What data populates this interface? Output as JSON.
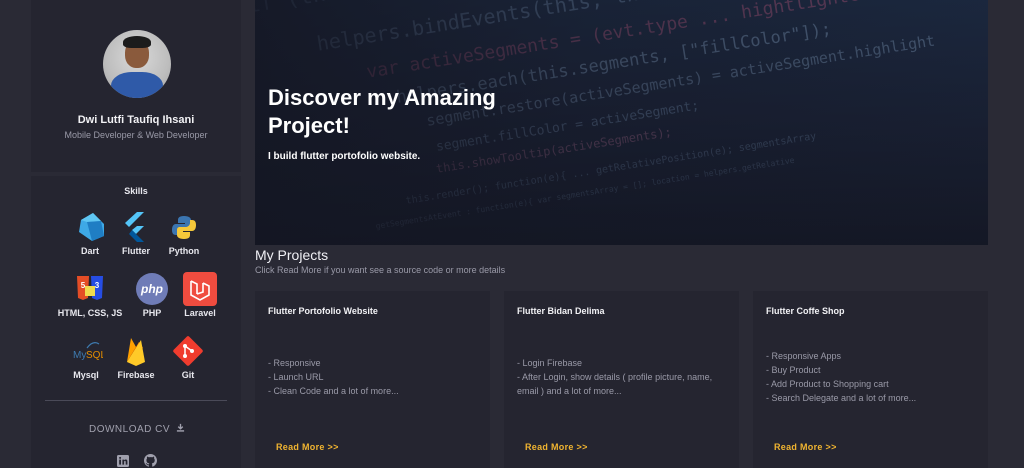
{
  "profile": {
    "name": "Dwi Lutfi Taufiq Ihsani",
    "role": "Mobile Developer & Web Developer"
  },
  "skills": {
    "title": "Skills",
    "items": [
      {
        "label": "Dart",
        "icon": "dart-icon"
      },
      {
        "label": "Flutter",
        "icon": "flutter-icon"
      },
      {
        "label": "Python",
        "icon": "python-icon"
      },
      {
        "label": "HTML, CSS, JS",
        "icon": "html-css-js-icon"
      },
      {
        "label": "PHP",
        "icon": "php-icon"
      },
      {
        "label": "Laravel",
        "icon": "laravel-icon"
      },
      {
        "label": "Mysql",
        "icon": "mysql-icon"
      },
      {
        "label": "Firebase",
        "icon": "firebase-icon"
      },
      {
        "label": "Git",
        "icon": "git-icon"
      }
    ]
  },
  "download": {
    "label": "DOWNLOAD CV",
    "icon": "download-icon"
  },
  "social": [
    {
      "icon": "linkedin-icon"
    },
    {
      "icon": "github-icon"
    }
  ],
  "hero": {
    "title": "Discover my Amazing Project!",
    "subtitle": "I build flutter portofolio website."
  },
  "projects": {
    "title": "My Projects",
    "subtitle": "Click Read More if you want see a source code or more details",
    "read_more": "Read More >>",
    "items": [
      {
        "title": "Flutter Portofolio Website",
        "lines": [
          "- Responsive",
          "- Launch URL",
          "- Clean Code and a lot of more..."
        ]
      },
      {
        "title": "Flutter Bidan Delima",
        "lines": [
          "- Login Firebase",
          "- After Login, show details ( profile picture, name, email ) and a lot of more..."
        ]
      },
      {
        "title": "Flutter Coffe Shop",
        "lines": [
          "- Responsive Apps",
          "- Buy Product",
          "- Add Product to Shopping cart",
          "- Search Delegate and a lot of more..."
        ]
      }
    ]
  },
  "colors": {
    "background": "#2a2a35",
    "card": "#252530",
    "accent": "#f0b430",
    "muted": "#9a9aa8"
  }
}
